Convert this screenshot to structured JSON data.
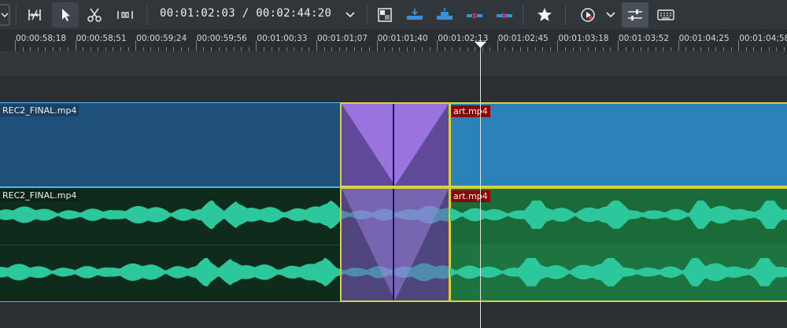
{
  "toolbar": {
    "timecode": "00:01:02:03 / 00:02:44:20",
    "icons": [
      "chevron-down-icon",
      "spacer-tool-icon",
      "select-tool-icon",
      "razor-tool-icon",
      "ripple-icon",
      "chevron-down-icon",
      "composite-icon",
      "insert-icon",
      "overwrite-icon",
      "lift-icon",
      "extract-icon",
      "favorite-icon",
      "record-icon",
      "chevron-down-icon",
      "mixer-icon",
      "keyboard-icon"
    ]
  },
  "ruler": {
    "labels": [
      "00:00:58;18",
      "00:00:58;51",
      "00:00:59;24",
      "00:00:59;56",
      "00:01:00;33",
      "00:01:01;07",
      "00:01:01;40",
      "00:01:02;13",
      "00:01:02;45",
      "00:01:03;18",
      "00:01:03;52",
      "00:01:04;25",
      "00:01:04;58"
    ]
  },
  "clips": {
    "video_left": "REC2_FINAL.mp4",
    "video_right": "art.mp4",
    "audio_left": "REC2_FINAL.mp4",
    "audio_right": "art.mp4"
  },
  "colors": {
    "video_clip": "#1f5079",
    "video_clip_right": "#2b82b9",
    "audio_clip": "#0e2b1c",
    "audio_clip_right": "#1a6a3a",
    "waveform": "#2cc79a",
    "transition": "#5f4a9a",
    "selection_border": "#d6d33a",
    "label_red": "#8b0000"
  }
}
